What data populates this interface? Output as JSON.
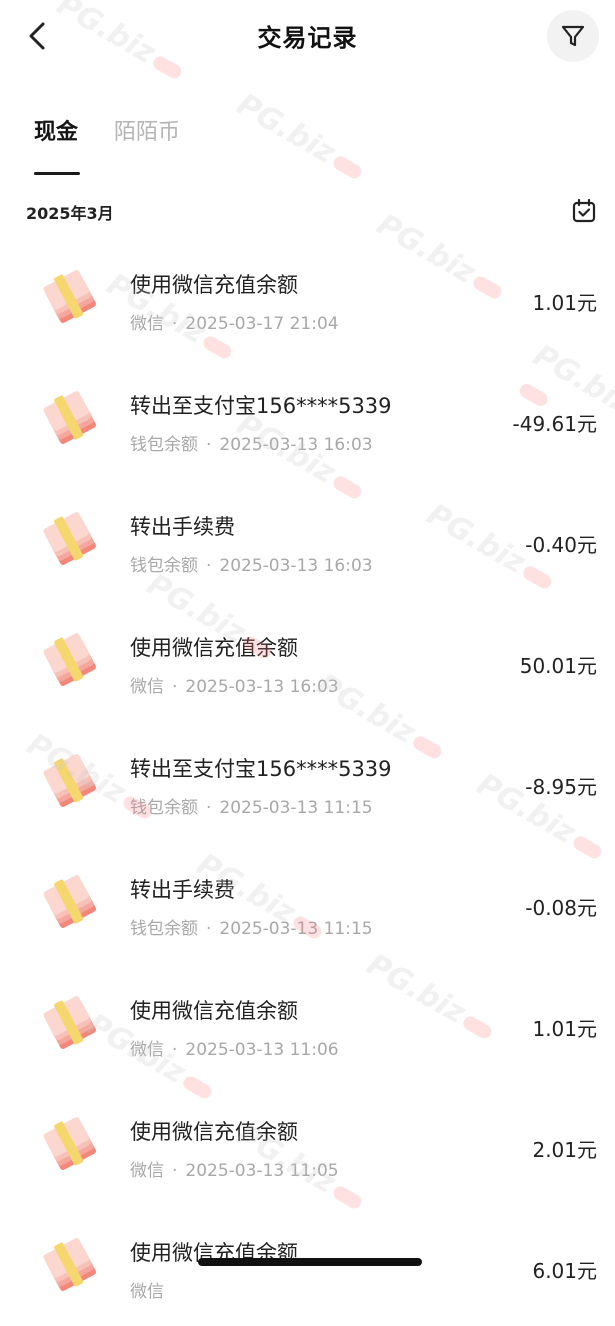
{
  "header": {
    "title": "交易记录",
    "back_icon": "chevron-left",
    "filter_icon": "funnel"
  },
  "tabs": [
    {
      "label": "现金",
      "active": true
    },
    {
      "label": "陌陌币",
      "active": false
    }
  ],
  "month": {
    "label": "2025年3月",
    "calendar_icon": "calendar-check"
  },
  "transactions": [
    {
      "title": "使用微信充值余额",
      "source": "微信",
      "time": "2025-03-17 21:04",
      "amount": "1.01元"
    },
    {
      "title": "转出至支付宝156****5339",
      "source": "钱包余额",
      "time": "2025-03-13 16:03",
      "amount": "-49.61元"
    },
    {
      "title": "转出手续费",
      "source": "钱包余额",
      "time": "2025-03-13 16:03",
      "amount": "-0.40元"
    },
    {
      "title": "使用微信充值余额",
      "source": "微信",
      "time": "2025-03-13 16:03",
      "amount": "50.01元"
    },
    {
      "title": "转出至支付宝156****5339",
      "source": "钱包余额",
      "time": "2025-03-13 11:15",
      "amount": "-8.95元"
    },
    {
      "title": "转出手续费",
      "source": "钱包余额",
      "time": "2025-03-13 11:15",
      "amount": "-0.08元"
    },
    {
      "title": "使用微信充值余额",
      "source": "微信",
      "time": "2025-03-13 11:06",
      "amount": "1.01元"
    },
    {
      "title": "使用微信充值余额",
      "source": "微信",
      "time": "2025-03-13 11:05",
      "amount": "2.01元"
    },
    {
      "title": "使用微信充值余额",
      "source": "微信",
      "time": "",
      "amount": "6.01元"
    }
  ],
  "separator": "·",
  "watermark": "PG.biz",
  "colors": {
    "primary_text": "#222222",
    "secondary_text": "#a8a8a8",
    "inactive_tab": "#b5b5b5",
    "money_yellow": "#f5d76e",
    "money_pink": "#f3a39a"
  }
}
